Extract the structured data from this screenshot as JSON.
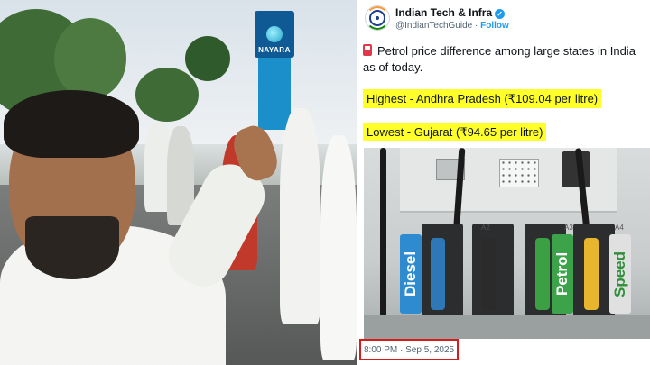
{
  "photo": {
    "sign_text": "NAYARA"
  },
  "tweet": {
    "author_name": "Indian Tech & Infra",
    "handle": "@IndianTechGuide",
    "separator": "·",
    "follow_label": "Follow",
    "body": "Petrol price difference among large states in India as of today.",
    "highest": "Highest - Andhra Pradesh (₹109.04 per litre)",
    "lowest": "Lowest - Gujarat (₹94.65 per litre)",
    "timestamp": "8:00 PM · Sep 5, 2025",
    "colors": {
      "highlight": "#ffff2a",
      "verified": "#1d9bf0",
      "timestamp_box": "#d71a1a"
    }
  },
  "pump_image": {
    "labels": {
      "diesel": "Diesel",
      "petrol": "Petrol",
      "speed": "Speed"
    },
    "tags": [
      "A2",
      "A3",
      "A4"
    ]
  }
}
